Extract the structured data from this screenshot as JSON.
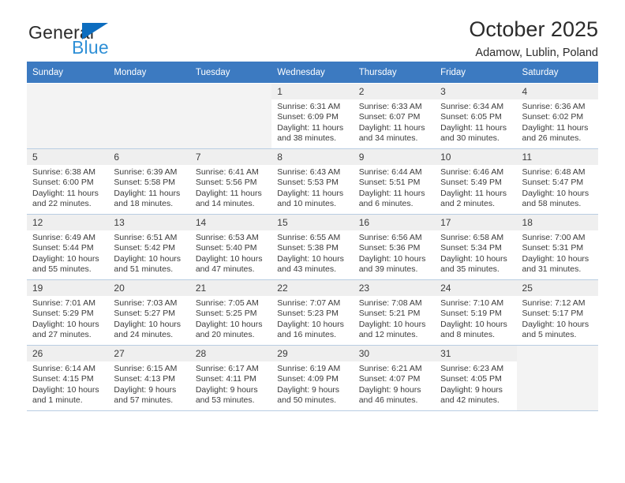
{
  "logo": {
    "word1": "General",
    "word2": "Blue",
    "triangle_color": "#0d6dbf",
    "word2_color": "#2e8fd6"
  },
  "header": {
    "title": "October 2025",
    "subtitle": "Adamow, Lublin, Poland"
  },
  "theme": {
    "header_blue": "#3c7ac1",
    "row_divider": "#b9cde2",
    "daynum_band": "#efefef",
    "empty_cell": "#f3f3f3"
  },
  "calendar": {
    "weekday_headers": [
      "Sunday",
      "Monday",
      "Tuesday",
      "Wednesday",
      "Thursday",
      "Friday",
      "Saturday"
    ],
    "labels": {
      "sunrise": "Sunrise:",
      "sunset": "Sunset:",
      "daylight": "Daylight:"
    },
    "weeks": [
      [
        {
          "day": "",
          "sunrise": "",
          "sunset": "",
          "daylight_1": "",
          "daylight_2": ""
        },
        {
          "day": "",
          "sunrise": "",
          "sunset": "",
          "daylight_1": "",
          "daylight_2": ""
        },
        {
          "day": "",
          "sunrise": "",
          "sunset": "",
          "daylight_1": "",
          "daylight_2": ""
        },
        {
          "day": "1",
          "sunrise": "Sunrise: 6:31 AM",
          "sunset": "Sunset: 6:09 PM",
          "daylight_1": "Daylight: 11 hours",
          "daylight_2": "and 38 minutes."
        },
        {
          "day": "2",
          "sunrise": "Sunrise: 6:33 AM",
          "sunset": "Sunset: 6:07 PM",
          "daylight_1": "Daylight: 11 hours",
          "daylight_2": "and 34 minutes."
        },
        {
          "day": "3",
          "sunrise": "Sunrise: 6:34 AM",
          "sunset": "Sunset: 6:05 PM",
          "daylight_1": "Daylight: 11 hours",
          "daylight_2": "and 30 minutes."
        },
        {
          "day": "4",
          "sunrise": "Sunrise: 6:36 AM",
          "sunset": "Sunset: 6:02 PM",
          "daylight_1": "Daylight: 11 hours",
          "daylight_2": "and 26 minutes."
        }
      ],
      [
        {
          "day": "5",
          "sunrise": "Sunrise: 6:38 AM",
          "sunset": "Sunset: 6:00 PM",
          "daylight_1": "Daylight: 11 hours",
          "daylight_2": "and 22 minutes."
        },
        {
          "day": "6",
          "sunrise": "Sunrise: 6:39 AM",
          "sunset": "Sunset: 5:58 PM",
          "daylight_1": "Daylight: 11 hours",
          "daylight_2": "and 18 minutes."
        },
        {
          "day": "7",
          "sunrise": "Sunrise: 6:41 AM",
          "sunset": "Sunset: 5:56 PM",
          "daylight_1": "Daylight: 11 hours",
          "daylight_2": "and 14 minutes."
        },
        {
          "day": "8",
          "sunrise": "Sunrise: 6:43 AM",
          "sunset": "Sunset: 5:53 PM",
          "daylight_1": "Daylight: 11 hours",
          "daylight_2": "and 10 minutes."
        },
        {
          "day": "9",
          "sunrise": "Sunrise: 6:44 AM",
          "sunset": "Sunset: 5:51 PM",
          "daylight_1": "Daylight: 11 hours",
          "daylight_2": "and 6 minutes."
        },
        {
          "day": "10",
          "sunrise": "Sunrise: 6:46 AM",
          "sunset": "Sunset: 5:49 PM",
          "daylight_1": "Daylight: 11 hours",
          "daylight_2": "and 2 minutes."
        },
        {
          "day": "11",
          "sunrise": "Sunrise: 6:48 AM",
          "sunset": "Sunset: 5:47 PM",
          "daylight_1": "Daylight: 10 hours",
          "daylight_2": "and 58 minutes."
        }
      ],
      [
        {
          "day": "12",
          "sunrise": "Sunrise: 6:49 AM",
          "sunset": "Sunset: 5:44 PM",
          "daylight_1": "Daylight: 10 hours",
          "daylight_2": "and 55 minutes."
        },
        {
          "day": "13",
          "sunrise": "Sunrise: 6:51 AM",
          "sunset": "Sunset: 5:42 PM",
          "daylight_1": "Daylight: 10 hours",
          "daylight_2": "and 51 minutes."
        },
        {
          "day": "14",
          "sunrise": "Sunrise: 6:53 AM",
          "sunset": "Sunset: 5:40 PM",
          "daylight_1": "Daylight: 10 hours",
          "daylight_2": "and 47 minutes."
        },
        {
          "day": "15",
          "sunrise": "Sunrise: 6:55 AM",
          "sunset": "Sunset: 5:38 PM",
          "daylight_1": "Daylight: 10 hours",
          "daylight_2": "and 43 minutes."
        },
        {
          "day": "16",
          "sunrise": "Sunrise: 6:56 AM",
          "sunset": "Sunset: 5:36 PM",
          "daylight_1": "Daylight: 10 hours",
          "daylight_2": "and 39 minutes."
        },
        {
          "day": "17",
          "sunrise": "Sunrise: 6:58 AM",
          "sunset": "Sunset: 5:34 PM",
          "daylight_1": "Daylight: 10 hours",
          "daylight_2": "and 35 minutes."
        },
        {
          "day": "18",
          "sunrise": "Sunrise: 7:00 AM",
          "sunset": "Sunset: 5:31 PM",
          "daylight_1": "Daylight: 10 hours",
          "daylight_2": "and 31 minutes."
        }
      ],
      [
        {
          "day": "19",
          "sunrise": "Sunrise: 7:01 AM",
          "sunset": "Sunset: 5:29 PM",
          "daylight_1": "Daylight: 10 hours",
          "daylight_2": "and 27 minutes."
        },
        {
          "day": "20",
          "sunrise": "Sunrise: 7:03 AM",
          "sunset": "Sunset: 5:27 PM",
          "daylight_1": "Daylight: 10 hours",
          "daylight_2": "and 24 minutes."
        },
        {
          "day": "21",
          "sunrise": "Sunrise: 7:05 AM",
          "sunset": "Sunset: 5:25 PM",
          "daylight_1": "Daylight: 10 hours",
          "daylight_2": "and 20 minutes."
        },
        {
          "day": "22",
          "sunrise": "Sunrise: 7:07 AM",
          "sunset": "Sunset: 5:23 PM",
          "daylight_1": "Daylight: 10 hours",
          "daylight_2": "and 16 minutes."
        },
        {
          "day": "23",
          "sunrise": "Sunrise: 7:08 AM",
          "sunset": "Sunset: 5:21 PM",
          "daylight_1": "Daylight: 10 hours",
          "daylight_2": "and 12 minutes."
        },
        {
          "day": "24",
          "sunrise": "Sunrise: 7:10 AM",
          "sunset": "Sunset: 5:19 PM",
          "daylight_1": "Daylight: 10 hours",
          "daylight_2": "and 8 minutes."
        },
        {
          "day": "25",
          "sunrise": "Sunrise: 7:12 AM",
          "sunset": "Sunset: 5:17 PM",
          "daylight_1": "Daylight: 10 hours",
          "daylight_2": "and 5 minutes."
        }
      ],
      [
        {
          "day": "26",
          "sunrise": "Sunrise: 6:14 AM",
          "sunset": "Sunset: 4:15 PM",
          "daylight_1": "Daylight: 10 hours",
          "daylight_2": "and 1 minute."
        },
        {
          "day": "27",
          "sunrise": "Sunrise: 6:15 AM",
          "sunset": "Sunset: 4:13 PM",
          "daylight_1": "Daylight: 9 hours",
          "daylight_2": "and 57 minutes."
        },
        {
          "day": "28",
          "sunrise": "Sunrise: 6:17 AM",
          "sunset": "Sunset: 4:11 PM",
          "daylight_1": "Daylight: 9 hours",
          "daylight_2": "and 53 minutes."
        },
        {
          "day": "29",
          "sunrise": "Sunrise: 6:19 AM",
          "sunset": "Sunset: 4:09 PM",
          "daylight_1": "Daylight: 9 hours",
          "daylight_2": "and 50 minutes."
        },
        {
          "day": "30",
          "sunrise": "Sunrise: 6:21 AM",
          "sunset": "Sunset: 4:07 PM",
          "daylight_1": "Daylight: 9 hours",
          "daylight_2": "and 46 minutes."
        },
        {
          "day": "31",
          "sunrise": "Sunrise: 6:23 AM",
          "sunset": "Sunset: 4:05 PM",
          "daylight_1": "Daylight: 9 hours",
          "daylight_2": "and 42 minutes."
        },
        {
          "day": "",
          "sunrise": "",
          "sunset": "",
          "daylight_1": "",
          "daylight_2": ""
        }
      ]
    ]
  }
}
